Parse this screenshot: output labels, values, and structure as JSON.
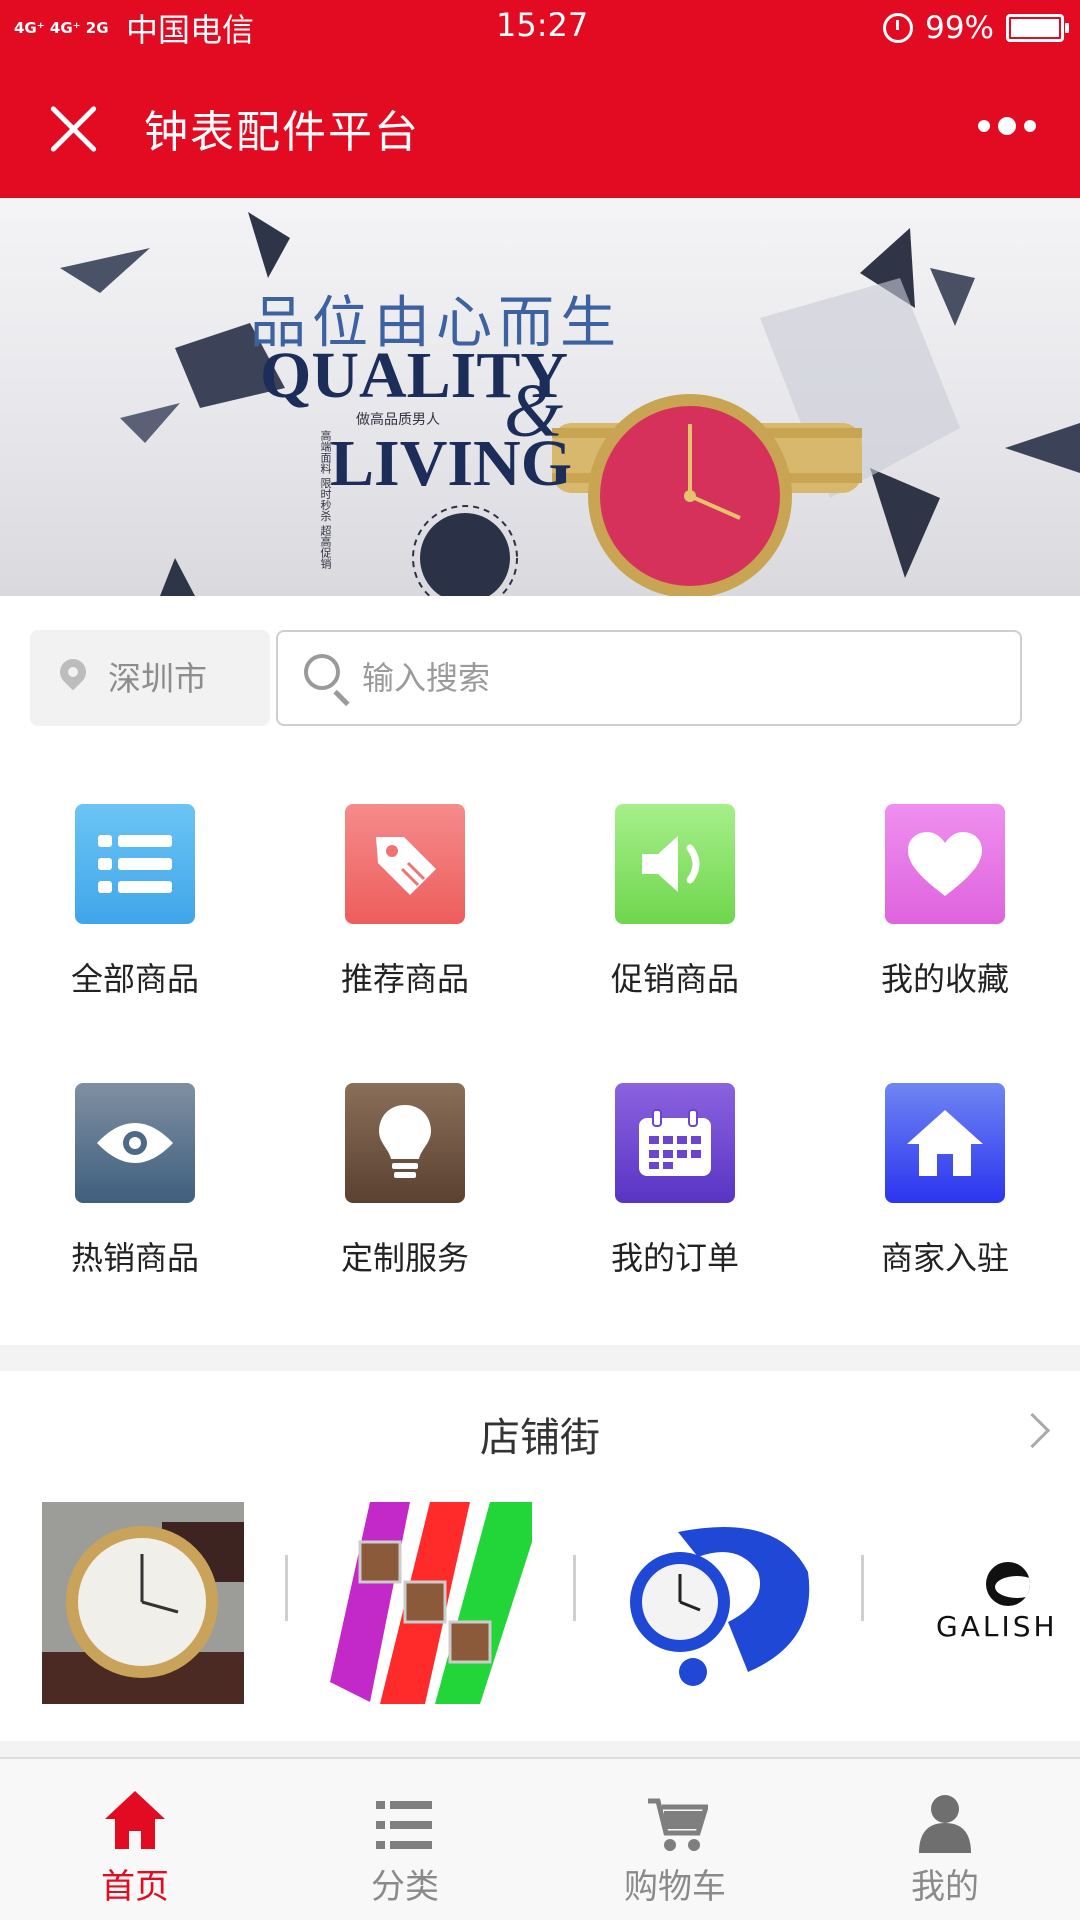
{
  "status_bar": {
    "network": "4G⁺ 4G⁺ 2G",
    "carrier": "中国电信",
    "time": "15:27",
    "battery": "99%"
  },
  "header": {
    "title": "钟表配件平台"
  },
  "banner": {
    "chinese_text": "品位由心而生",
    "quality_text": "QUALITY",
    "ampersand": "&",
    "living_text": "LIVING",
    "subtitle": "做高品质男人",
    "vertical_text": "高端面料 限时秒杀 超高促销"
  },
  "location": {
    "city": "深圳市"
  },
  "search": {
    "placeholder": "输入搜索",
    "value": ""
  },
  "categories": [
    {
      "label": "全部商品",
      "icon": "list-icon",
      "color": "#4db0ef"
    },
    {
      "label": "推荐商品",
      "icon": "tag-icon",
      "color": "#f06d6d"
    },
    {
      "label": "促销商品",
      "icon": "speaker-icon",
      "color": "#8be26b"
    },
    {
      "label": "我的收藏",
      "icon": "heart-icon",
      "color": "#e47ae2"
    },
    {
      "label": "热销商品",
      "icon": "eye-icon",
      "color": "#4e6a86"
    },
    {
      "label": "定制服务",
      "icon": "lightbulb-icon",
      "color": "#6d5340"
    },
    {
      "label": "我的订单",
      "icon": "calendar-icon",
      "color": "#6c45cf"
    },
    {
      "label": "商家入驻",
      "icon": "home-icon",
      "color": "#3a4af2"
    }
  ],
  "shop_street": {
    "title": "店铺街",
    "galish": "GALISH"
  },
  "tabbar": [
    {
      "label": "首页",
      "icon": "home-icon",
      "active": true
    },
    {
      "label": "分类",
      "icon": "list-icon",
      "active": false
    },
    {
      "label": "购物车",
      "icon": "cart-icon",
      "active": false
    },
    {
      "label": "我的",
      "icon": "user-icon",
      "active": false
    }
  ],
  "colors": {
    "brand": "#e30b22",
    "tab_active": "#e30b22",
    "tab_inactive": "#8a8a8a"
  }
}
